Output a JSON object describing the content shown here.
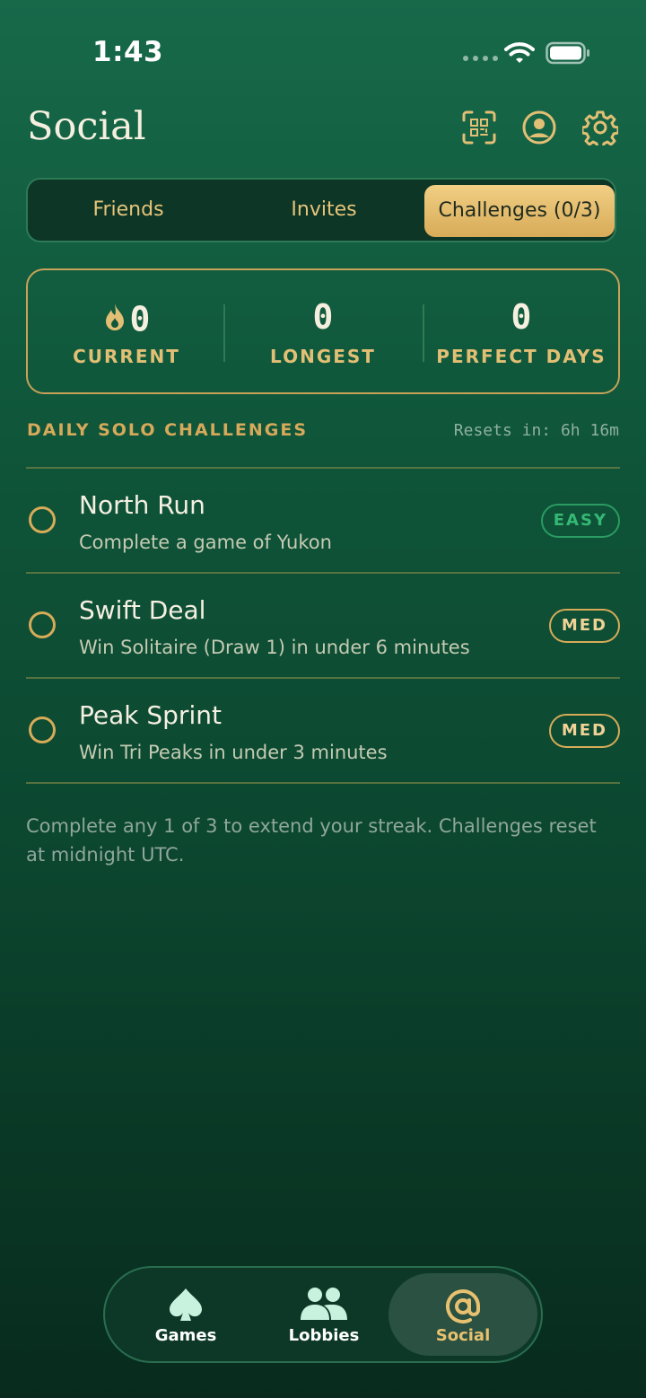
{
  "status": {
    "time": "1:43"
  },
  "header": {
    "title": "Social",
    "icons": [
      "qr-scan-icon",
      "profile-icon",
      "gear-icon"
    ]
  },
  "tabs": [
    {
      "label": "Friends",
      "active": false
    },
    {
      "label": "Invites",
      "active": false
    },
    {
      "label": "Challenges (0/3)",
      "active": true
    }
  ],
  "stats": [
    {
      "value": "0",
      "label": "CURRENT",
      "icon": "flame-icon"
    },
    {
      "value": "0",
      "label": "LONGEST"
    },
    {
      "value": "0",
      "label": "PERFECT DAYS"
    }
  ],
  "section": {
    "title": "DAILY SOLO CHALLENGES",
    "reset": "Resets in: 6h 16m"
  },
  "challenges": [
    {
      "name": "North Run",
      "description": "Complete a game of Yukon",
      "difficulty": "EASY"
    },
    {
      "name": "Swift Deal",
      "description": "Win Solitaire (Draw 1) in under 6 minutes",
      "difficulty": "MED"
    },
    {
      "name": "Peak Sprint",
      "description": "Win Tri Peaks in under 3 minutes",
      "difficulty": "MED"
    }
  ],
  "footnote": "Complete any 1 of 3 to extend your streak. Challenges reset at midnight UTC.",
  "nav": [
    {
      "label": "Games",
      "icon": "spade-icon",
      "active": false
    },
    {
      "label": "Lobbies",
      "icon": "people-icon",
      "active": false
    },
    {
      "label": "Social",
      "icon": "at-icon",
      "active": true
    }
  ],
  "colors": {
    "accent": "#d7ab58",
    "easy": "#35b874",
    "background": "#0f563a"
  }
}
